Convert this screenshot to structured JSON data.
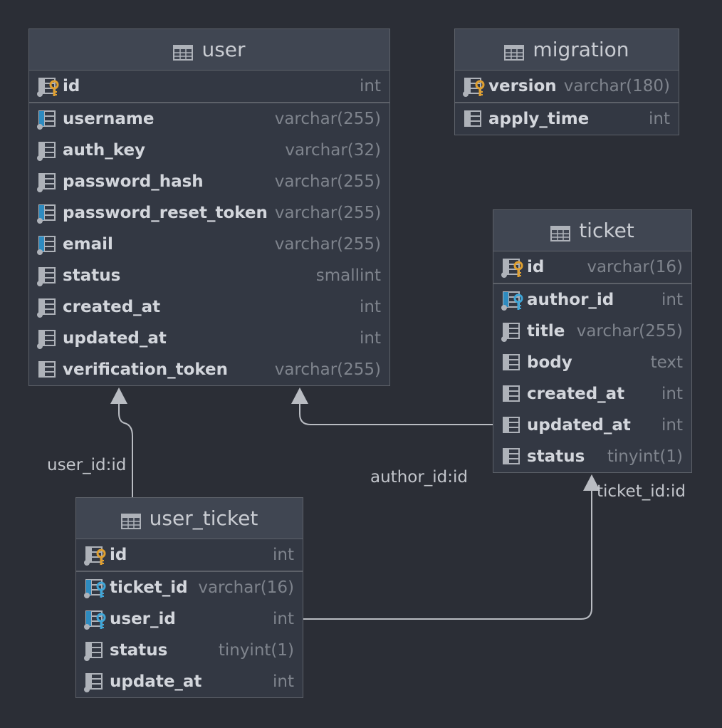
{
  "colors": {
    "background": "#2b2e36",
    "table_bg": "#333843",
    "header_bg": "#404652",
    "border": "#5d6169",
    "primary_key_icon": "#e0a030",
    "foreign_key_icon": "#3fa6d8",
    "unique_marker": "#2e8bc0",
    "connector": "#b9bcc2"
  },
  "tables": [
    {
      "id": "user",
      "name": "user",
      "icon": "table-icon",
      "columns": [
        {
          "name": "id",
          "type": "int",
          "icon": "primary-key-icon"
        },
        {
          "name": "username",
          "type": "varchar(255)",
          "icon": "unique-column-icon"
        },
        {
          "name": "auth_key",
          "type": "varchar(32)",
          "icon": "column-icon"
        },
        {
          "name": "password_hash",
          "type": "varchar(255)",
          "icon": "column-icon"
        },
        {
          "name": "password_reset_token",
          "type": "varchar(255)",
          "icon": "unique-column-icon"
        },
        {
          "name": "email",
          "type": "varchar(255)",
          "icon": "unique-column-icon"
        },
        {
          "name": "status",
          "type": "smallint",
          "icon": "column-icon"
        },
        {
          "name": "created_at",
          "type": "int",
          "icon": "column-icon"
        },
        {
          "name": "updated_at",
          "type": "int",
          "icon": "column-icon"
        },
        {
          "name": "verification_token",
          "type": "varchar(255)",
          "icon": "nullable-column-icon"
        }
      ]
    },
    {
      "id": "migration",
      "name": "migration",
      "icon": "table-icon",
      "columns": [
        {
          "name": "version",
          "type": "varchar(180)",
          "icon": "primary-key-icon"
        },
        {
          "name": "apply_time",
          "type": "int",
          "icon": "nullable-column-icon"
        }
      ]
    },
    {
      "id": "ticket",
      "name": "ticket",
      "icon": "table-icon",
      "columns": [
        {
          "name": "id",
          "type": "varchar(16)",
          "icon": "primary-key-icon"
        },
        {
          "name": "author_id",
          "type": "int",
          "icon": "foreign-key-icon"
        },
        {
          "name": "title",
          "type": "varchar(255)",
          "icon": "column-icon"
        },
        {
          "name": "body",
          "type": "text",
          "icon": "nullable-column-icon"
        },
        {
          "name": "created_at",
          "type": "int",
          "icon": "nullable-column-icon"
        },
        {
          "name": "updated_at",
          "type": "int",
          "icon": "nullable-column-icon"
        },
        {
          "name": "status",
          "type": "tinyint(1)",
          "icon": "nullable-column-icon"
        }
      ]
    },
    {
      "id": "user_ticket",
      "name": "user_ticket",
      "icon": "table-icon",
      "columns": [
        {
          "name": "id",
          "type": "int",
          "icon": "primary-key-icon"
        },
        {
          "name": "ticket_id",
          "type": "varchar(16)",
          "icon": "foreign-key-icon"
        },
        {
          "name": "user_id",
          "type": "int",
          "icon": "foreign-key-icon"
        },
        {
          "name": "status",
          "type": "tinyint(1)",
          "icon": "column-icon"
        },
        {
          "name": "update_at",
          "type": "int",
          "icon": "column-icon"
        }
      ]
    }
  ],
  "relations": [
    {
      "from": "user_ticket",
      "to": "user",
      "label": "user_id:id"
    },
    {
      "from": "ticket",
      "to": "user",
      "label": "author_id:id"
    },
    {
      "from": "user_ticket",
      "to": "ticket",
      "label": "ticket_id:id"
    }
  ]
}
